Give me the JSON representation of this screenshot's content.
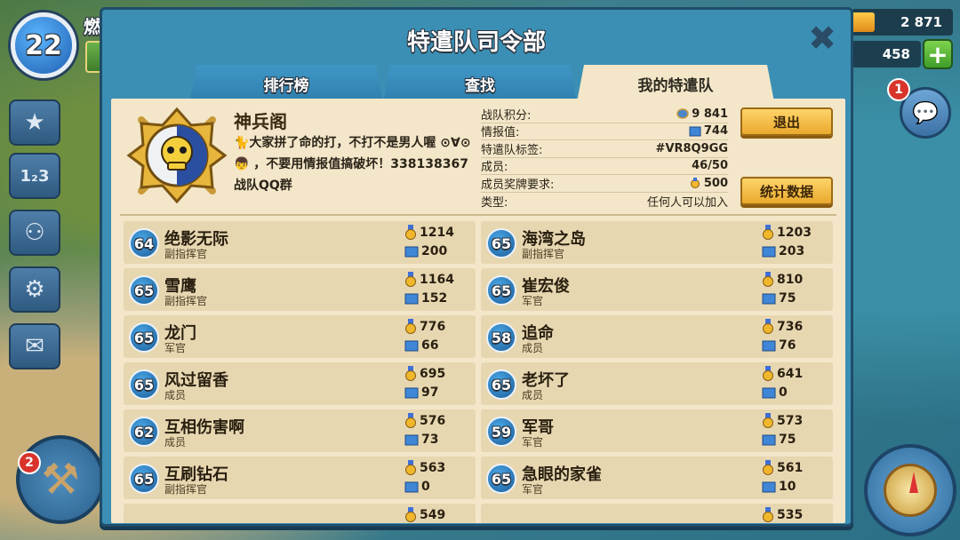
{
  "player": {
    "level": "22",
    "name": "燃"
  },
  "resources": {
    "gold": "2 871",
    "diamonds": "458"
  },
  "notifications": {
    "chat_count": "1",
    "build_count": "2"
  },
  "panel": {
    "title": "特遣队司令部",
    "tabs": [
      {
        "label": "排行榜",
        "active": false
      },
      {
        "label": "查找",
        "active": false
      },
      {
        "label": "我的特遣队",
        "active": true
      }
    ]
  },
  "guild": {
    "name": "神兵阁",
    "description": "🐈大家拼了命的打，不打不是男人喔 ⊙∀⊙👦 ，不要用情报值搞破坏！338138367战队QQ群",
    "info": [
      {
        "label": "战队积分:",
        "value": "9 841",
        "icon": "rank-badge-icon"
      },
      {
        "label": "情报值:",
        "value": "744",
        "icon": "intel-icon"
      },
      {
        "label": "特遣队标签:",
        "value": "#VR8Q9GG",
        "icon": ""
      },
      {
        "label": "成员:",
        "value": "46/50",
        "icon": ""
      },
      {
        "label": "成员奖牌要求:",
        "value": "500",
        "icon": "medal-icon"
      },
      {
        "label": "类型:",
        "value": "任何人可以加入",
        "icon": ""
      }
    ],
    "buttons": {
      "leave": "退出",
      "stats": "统计数据"
    }
  },
  "members": [
    {
      "level": "64",
      "name": "绝影无际",
      "role": "副指挥官",
      "medals": "1214",
      "intel": "200"
    },
    {
      "level": "65",
      "name": "海湾之岛",
      "role": "副指挥官",
      "medals": "1203",
      "intel": "203"
    },
    {
      "level": "65",
      "name": "雪鹰",
      "role": "副指挥官",
      "medals": "1164",
      "intel": "152"
    },
    {
      "level": "65",
      "name": "崔宏俊",
      "role": "军官",
      "medals": "810",
      "intel": "75"
    },
    {
      "level": "65",
      "name": "龙门",
      "role": "军官",
      "medals": "776",
      "intel": "66"
    },
    {
      "level": "58",
      "name": "追命",
      "role": "成员",
      "medals": "736",
      "intel": "76"
    },
    {
      "level": "65",
      "name": "风过留香",
      "role": "成员",
      "medals": "695",
      "intel": "97"
    },
    {
      "level": "65",
      "name": "老坏了",
      "role": "成员",
      "medals": "641",
      "intel": "0"
    },
    {
      "level": "62",
      "name": "互相伤害啊",
      "role": "成员",
      "medals": "576",
      "intel": "73"
    },
    {
      "level": "59",
      "name": "军哥",
      "role": "军官",
      "medals": "573",
      "intel": "75"
    },
    {
      "level": "65",
      "name": "互刷钻石",
      "role": "副指挥官",
      "medals": "563",
      "intel": "0"
    },
    {
      "level": "65",
      "name": "急眼的家雀",
      "role": "军官",
      "medals": "561",
      "intel": "10"
    },
    {
      "level": "",
      "name": "",
      "role": "",
      "medals": "549",
      "intel": ""
    },
    {
      "level": "",
      "name": "",
      "role": "",
      "medals": "535",
      "intel": ""
    }
  ]
}
